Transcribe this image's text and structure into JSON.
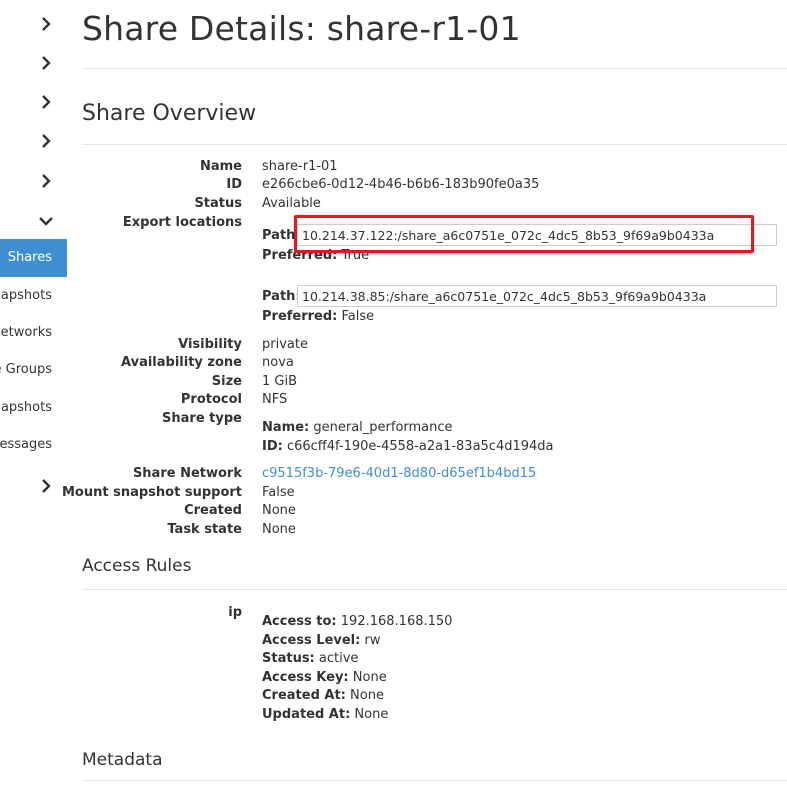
{
  "sidebar": {
    "items": [
      {
        "label": "Shares",
        "active": true
      },
      {
        "label": "Share Snapshots"
      },
      {
        "label": "Share Networks"
      },
      {
        "label": "Share Groups"
      },
      {
        "label": "Share Group Snapshots"
      },
      {
        "label": "User Messages"
      }
    ]
  },
  "page": {
    "title": "Share Details: share-r1-01"
  },
  "overview": {
    "heading": "Share Overview",
    "name_label": "Name",
    "name": "share-r1-01",
    "id_label": "ID",
    "id": "e266cbe6-0d12-4b46-b6b6-183b90fe0a35",
    "status_label": "Status",
    "status": "Available",
    "export_label": "Export locations",
    "exports": [
      {
        "path_label": "Path:",
        "path": "10.214.37.122:/share_a6c0751e_072c_4dc5_8b53_9f69a9b0433a",
        "preferred_label": "Preferred:",
        "preferred": "True"
      },
      {
        "path_label": "Path:",
        "path": "10.214.38.85:/share_a6c0751e_072c_4dc5_8b53_9f69a9b0433a",
        "preferred_label": "Preferred:",
        "preferred": "False"
      }
    ],
    "visibility_label": "Visibility",
    "visibility": "private",
    "az_label": "Availability zone",
    "az": "nova",
    "size_label": "Size",
    "size": "1 GiB",
    "protocol_label": "Protocol",
    "protocol": "NFS",
    "share_type_label": "Share type",
    "share_type_name_label": "Name:",
    "share_type_name": "general_performance",
    "share_type_id_label": "ID:",
    "share_type_id": "c66cff4f-190e-4558-a2a1-83a5c4d194da",
    "network_label": "Share Network",
    "network": "c9515f3b-79e6-40d1-8d80-d65ef1b4bd15",
    "mount_label": "Mount snapshot support",
    "mount": "False",
    "created_label": "Created",
    "created": "None",
    "task_label": "Task state",
    "task": "None"
  },
  "access": {
    "heading": "Access Rules",
    "type_label": "ip",
    "access_to_label": "Access to:",
    "access_to": "192.168.168.150",
    "level_label": "Access Level:",
    "level": "rw",
    "status_label": "Status:",
    "status": "active",
    "key_label": "Access Key:",
    "key": "None",
    "created_label": "Created At:",
    "created": "None",
    "updated_label": "Updated At:",
    "updated": "None"
  },
  "metadata": {
    "heading": "Metadata"
  },
  "colors": {
    "accent": "#3f8ed1",
    "highlight": "#e0191f",
    "text": "#333333"
  }
}
